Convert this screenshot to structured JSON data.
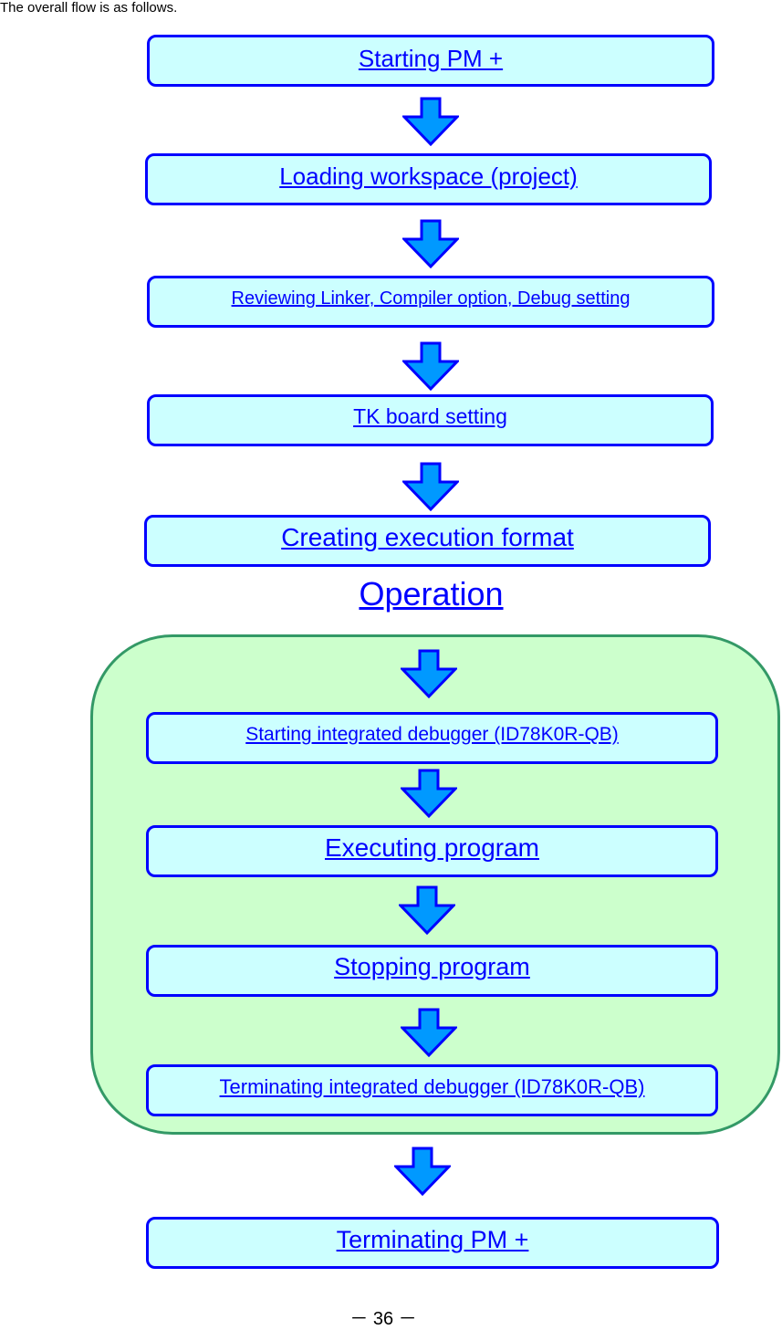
{
  "intro_text": "The overall flow is as follows.",
  "steps": [
    {
      "label": "Starting PM +"
    },
    {
      "label": "Loading workspace (project)"
    },
    {
      "label": "Reviewing Linker, Compiler option, Debug setting"
    },
    {
      "label": "TK board setting"
    },
    {
      "label": "Creating execution format"
    }
  ],
  "operation": {
    "title": "Operation",
    "steps": [
      {
        "label": "Starting integrated debugger (ID78K0R-QB)"
      },
      {
        "label": "Executing program"
      },
      {
        "label": "Stopping program"
      },
      {
        "label": "Terminating integrated debugger (ID78K0R-QB)"
      }
    ]
  },
  "final_step": {
    "label": "Terminating PM +"
  },
  "page_number": "－ 36 －",
  "colors": {
    "box_fill": "#ccffff",
    "box_border": "#0000ff",
    "arrow_fill": "#0099ff",
    "group_fill": "#ccffcc",
    "group_border": "#339966"
  }
}
